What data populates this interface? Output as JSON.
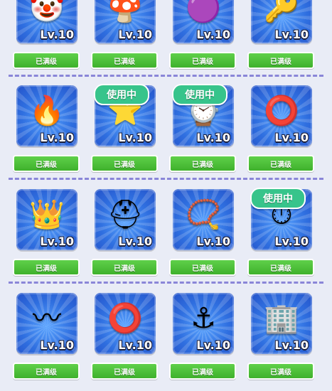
{
  "colors": {
    "card_blue": "#2f6fe0",
    "button_green": "#3fb12c",
    "using_green": "#37c48b",
    "divider": "#8a86d8"
  },
  "rows": [
    {
      "items": [
        {
          "level": "Lv.10",
          "icon_name": "clown-face-icon",
          "glyph": "🤡",
          "button": "已满级",
          "using": ""
        },
        {
          "level": "Lv.10",
          "icon_name": "mushroom-head-icon",
          "glyph": "🍄",
          "button": "已满级",
          "using": ""
        },
        {
          "level": "Lv.10",
          "icon_name": "purple-ball-icon",
          "glyph": "🟣",
          "button": "已满级",
          "using": ""
        },
        {
          "level": "Lv.10",
          "icon_name": "wind-up-key-icon",
          "glyph": "🔑",
          "button": "已满级",
          "using": ""
        }
      ]
    },
    {
      "items": [
        {
          "level": "Lv.10",
          "icon_name": "fire-fez-hat-icon",
          "glyph": "🔥",
          "button": "已满级",
          "using": ""
        },
        {
          "level": "Lv.10",
          "icon_name": "star-medal-icon",
          "glyph": "⭐",
          "button": "已满级",
          "using": "使用中"
        },
        {
          "level": "Lv.10",
          "icon_name": "wristwatch-icon",
          "glyph": "⌚",
          "button": "已满级",
          "using": "使用中"
        },
        {
          "level": "Lv.10",
          "icon_name": "gold-earrings-icon",
          "glyph": "⭕",
          "button": "已满级",
          "using": ""
        }
      ]
    },
    {
      "items": [
        {
          "level": "Lv.10",
          "icon_name": "crown-icon",
          "glyph": "👑",
          "button": "已满级",
          "using": ""
        },
        {
          "level": "Lv.10",
          "icon_name": "helmet-icon",
          "glyph": "⛑",
          "button": "已满级",
          "using": ""
        },
        {
          "level": "Lv.10",
          "icon_name": "tooth-necklace-icon",
          "glyph": "📿",
          "button": "已满级",
          "using": ""
        },
        {
          "level": "Lv.10",
          "icon_name": "gold-watch-icon",
          "glyph": "⏱",
          "button": "已满级",
          "using": "使用中"
        }
      ]
    },
    {
      "items": [
        {
          "level": "Lv.10",
          "icon_name": "gold-ornament-icon",
          "glyph": "〰",
          "button": "已满级",
          "using": ""
        },
        {
          "level": "Lv.10",
          "icon_name": "gold-ring-icon",
          "glyph": "⭕",
          "button": "已满级",
          "using": ""
        },
        {
          "level": "Lv.10",
          "icon_name": "anchor-icon",
          "glyph": "⚓",
          "button": "已满级",
          "using": ""
        },
        {
          "level": "Lv.10",
          "icon_name": "building-icon",
          "glyph": "🏢",
          "button": "已满级",
          "using": ""
        }
      ]
    }
  ]
}
